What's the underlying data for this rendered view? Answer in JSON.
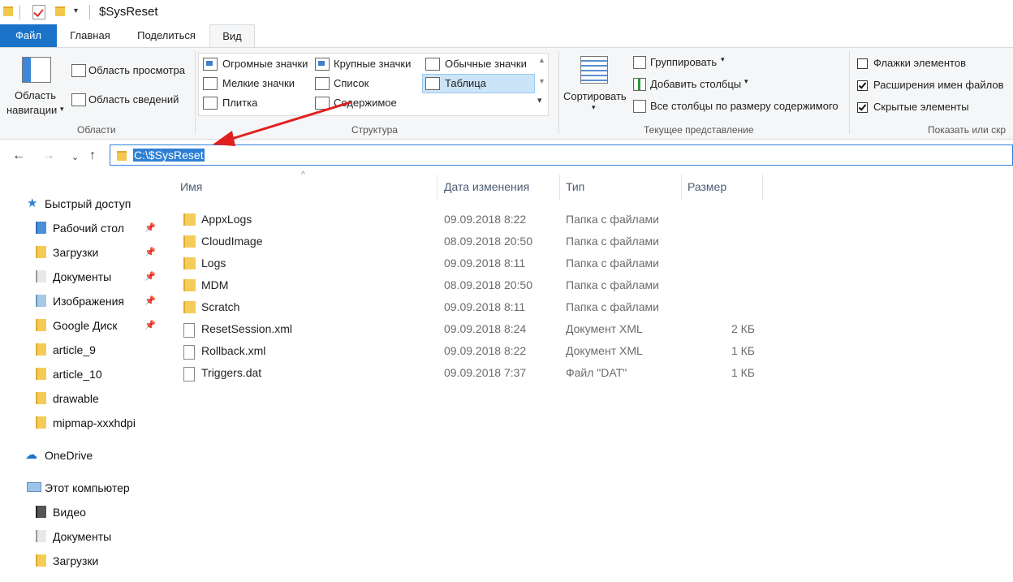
{
  "window": {
    "title": "$SysReset"
  },
  "ribbon_tabs": [
    {
      "label": "Файл"
    },
    {
      "label": "Главная"
    },
    {
      "label": "Поделиться"
    },
    {
      "label": "Вид"
    }
  ],
  "ribbon": {
    "panes": {
      "nav_line1": "Область",
      "nav_line2": "навигации",
      "preview": "Область просмотра",
      "details": "Область сведений",
      "group_label": "Области"
    },
    "layout": {
      "items": [
        "Огромные значки",
        "Крупные значки",
        "Обычные значки",
        "Мелкие значки",
        "Список",
        "Таблица",
        "Плитка",
        "Содержимое"
      ],
      "selected": "Таблица",
      "group_label": "Структура"
    },
    "current_view": {
      "sort": "Сортировать",
      "group_by": "Группировать",
      "add_columns": "Добавить столбцы",
      "fit_columns": "Все столбцы по размеру содержимого",
      "group_label": "Текущее представление"
    },
    "show_hide": {
      "item_checkboxes": {
        "label": "Флажки элементов",
        "checked": false
      },
      "file_extensions": {
        "label": "Расширения имен файлов",
        "checked": true
      },
      "hidden_items": {
        "label": "Скрытые элементы",
        "checked": true
      },
      "group_label": "Показать или скр"
    }
  },
  "address": {
    "path": "C:\\$SysReset"
  },
  "nav_pane": {
    "quick_access": "Быстрый доступ",
    "quick_items": [
      "Рабочий стол",
      "Загрузки",
      "Документы",
      "Изображения",
      "Google Диск",
      "article_9",
      "article_10",
      "drawable",
      "mipmap-xxxhdpi"
    ],
    "onedrive": "OneDrive",
    "this_pc": "Этот компьютер",
    "pc_items": [
      "Видео",
      "Документы",
      "Загрузки"
    ]
  },
  "columns": {
    "name": "Имя",
    "date": "Дата изменения",
    "type": "Тип",
    "size": "Размер"
  },
  "files": [
    {
      "name": "AppxLogs",
      "date": "09.09.2018 8:22",
      "type": "Папка с файлами",
      "size": "",
      "kind": "folder"
    },
    {
      "name": "CloudImage",
      "date": "08.09.2018 20:50",
      "type": "Папка с файлами",
      "size": "",
      "kind": "folder"
    },
    {
      "name": "Logs",
      "date": "09.09.2018 8:11",
      "type": "Папка с файлами",
      "size": "",
      "kind": "folder"
    },
    {
      "name": "MDM",
      "date": "08.09.2018 20:50",
      "type": "Папка с файлами",
      "size": "",
      "kind": "folder"
    },
    {
      "name": "Scratch",
      "date": "09.09.2018 8:11",
      "type": "Папка с файлами",
      "size": "",
      "kind": "folder"
    },
    {
      "name": "ResetSession.xml",
      "date": "09.09.2018 8:24",
      "type": "Документ XML",
      "size": "2 КБ",
      "kind": "file"
    },
    {
      "name": "Rollback.xml",
      "date": "09.09.2018 8:22",
      "type": "Документ XML",
      "size": "1 КБ",
      "kind": "file"
    },
    {
      "name": "Triggers.dat",
      "date": "09.09.2018 7:37",
      "type": "Файл \"DAT\"",
      "size": "1 КБ",
      "kind": "file"
    }
  ],
  "colors": {
    "accent": "#1a73c9",
    "annotation_arrow": "#e02020"
  }
}
